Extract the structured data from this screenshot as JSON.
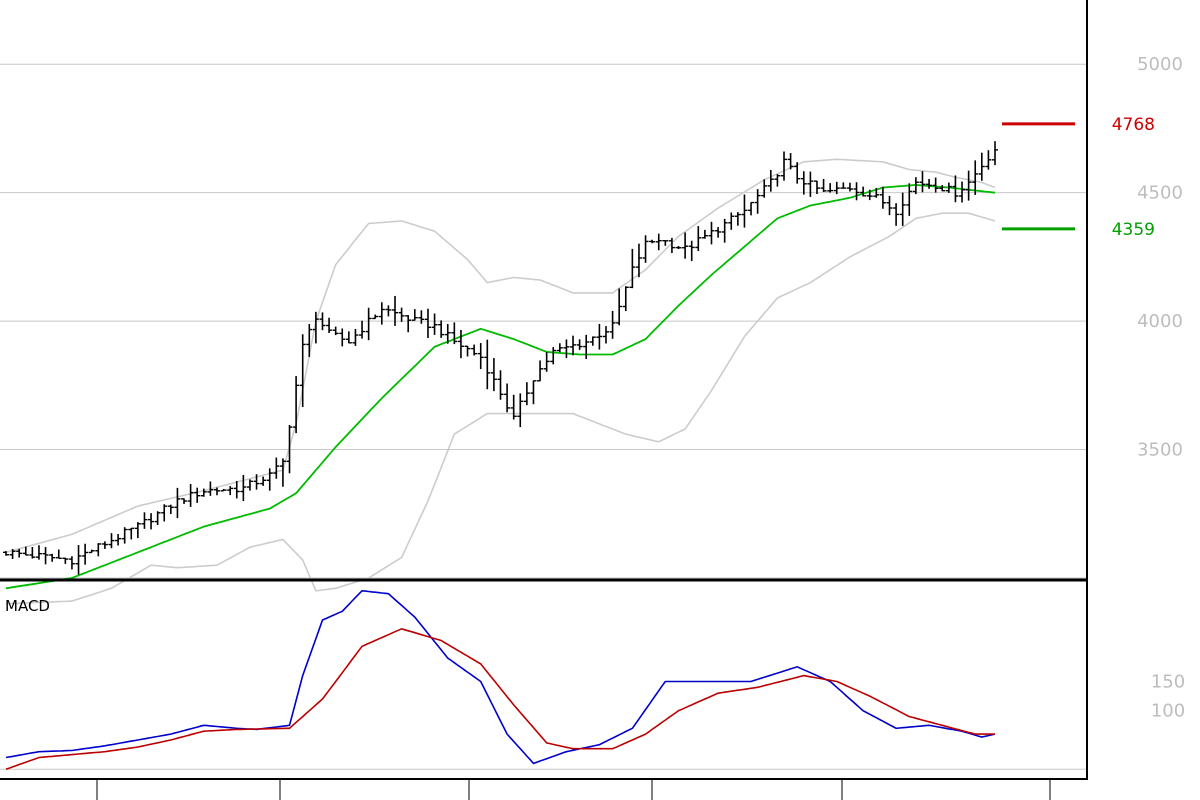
{
  "chart_data": [
    {
      "type": "ohlc",
      "panel": "price",
      "y_scale": "linear",
      "ylim": [
        3000,
        5250
      ],
      "y_ticks": [
        3500,
        4000,
        4500,
        5000
      ],
      "y_tick_labels": [
        "3500",
        "4000",
        "4500",
        "5000"
      ],
      "horizontal_grid_values": [
        3000,
        3500,
        4000,
        4500,
        5000
      ],
      "grid": "horizontal",
      "x_tick_labels_visible": false,
      "markers": [
        {
          "label": "4768",
          "value": 4768,
          "color": "#cc0000"
        },
        {
          "label": "4359",
          "value": 4359,
          "color": "#00a000"
        }
      ],
      "ohlc_keypoints": [
        [
          0,
          3100
        ],
        [
          10,
          3070
        ],
        [
          20,
          3200
        ],
        [
          26,
          3300
        ],
        [
          30,
          3340
        ],
        [
          36,
          3350
        ],
        [
          40,
          3400
        ],
        [
          42,
          3450
        ],
        [
          45,
          3900
        ],
        [
          47,
          4020
        ],
        [
          49,
          3950
        ],
        [
          52,
          3920
        ],
        [
          57,
          4050
        ],
        [
          62,
          4000
        ],
        [
          65,
          3980
        ],
        [
          68,
          3920
        ],
        [
          72,
          3860
        ],
        [
          75,
          3720
        ],
        [
          77,
          3620
        ],
        [
          80,
          3780
        ],
        [
          83,
          3880
        ],
        [
          88,
          3920
        ],
        [
          92,
          3980
        ],
        [
          95,
          4200
        ],
        [
          97,
          4300
        ],
        [
          99,
          4320
        ],
        [
          103,
          4280
        ],
        [
          108,
          4360
        ],
        [
          112,
          4430
        ],
        [
          116,
          4540
        ],
        [
          118,
          4620
        ],
        [
          120,
          4560
        ],
        [
          124,
          4500
        ],
        [
          128,
          4520
        ],
        [
          132,
          4480
        ],
        [
          135,
          4430
        ],
        [
          138,
          4540
        ],
        [
          141,
          4530
        ],
        [
          144,
          4500
        ],
        [
          146,
          4540
        ],
        [
          149,
          4640
        ],
        [
          150,
          4670
        ]
      ],
      "moving_average": {
        "color": "#00bb00",
        "points": [
          [
            0,
            2960
          ],
          [
            10,
            3000
          ],
          [
            20,
            3100
          ],
          [
            30,
            3200
          ],
          [
            40,
            3270
          ],
          [
            44,
            3330
          ],
          [
            50,
            3510
          ],
          [
            57,
            3700
          ],
          [
            65,
            3900
          ],
          [
            72,
            3970
          ],
          [
            77,
            3930
          ],
          [
            82,
            3880
          ],
          [
            87,
            3870
          ],
          [
            92,
            3870
          ],
          [
            97,
            3930
          ],
          [
            102,
            4060
          ],
          [
            107,
            4180
          ],
          [
            112,
            4290
          ],
          [
            117,
            4400
          ],
          [
            122,
            4450
          ],
          [
            128,
            4480
          ],
          [
            133,
            4520
          ],
          [
            138,
            4530
          ],
          [
            143,
            4520
          ],
          [
            150,
            4500
          ]
        ]
      },
      "bollinger_bands": {
        "color": "#cccccc",
        "upper": [
          [
            0,
            3100
          ],
          [
            10,
            3170
          ],
          [
            20,
            3280
          ],
          [
            30,
            3340
          ],
          [
            42,
            3420
          ],
          [
            44,
            3600
          ],
          [
            47,
            4000
          ],
          [
            50,
            4220
          ],
          [
            55,
            4380
          ],
          [
            60,
            4390
          ],
          [
            65,
            4350
          ],
          [
            70,
            4240
          ],
          [
            73,
            4150
          ],
          [
            77,
            4170
          ],
          [
            81,
            4160
          ],
          [
            86,
            4110
          ],
          [
            92,
            4110
          ],
          [
            97,
            4200
          ],
          [
            102,
            4330
          ],
          [
            108,
            4440
          ],
          [
            115,
            4550
          ],
          [
            121,
            4620
          ],
          [
            126,
            4630
          ],
          [
            133,
            4620
          ],
          [
            137,
            4590
          ],
          [
            141,
            4580
          ],
          [
            144,
            4560
          ],
          [
            148,
            4540
          ],
          [
            150,
            4520
          ]
        ],
        "lower": [
          [
            0,
            2900
          ],
          [
            10,
            2910
          ],
          [
            16,
            2960
          ],
          [
            22,
            3050
          ],
          [
            26,
            3040
          ],
          [
            32,
            3050
          ],
          [
            37,
            3120
          ],
          [
            42,
            3150
          ],
          [
            45,
            3070
          ],
          [
            47,
            2950
          ],
          [
            50,
            2960
          ],
          [
            55,
            3000
          ],
          [
            60,
            3080
          ],
          [
            64,
            3300
          ],
          [
            68,
            3560
          ],
          [
            73,
            3640
          ],
          [
            79,
            3640
          ],
          [
            86,
            3640
          ],
          [
            94,
            3560
          ],
          [
            99,
            3530
          ],
          [
            103,
            3580
          ],
          [
            107,
            3730
          ],
          [
            112,
            3940
          ],
          [
            117,
            4090
          ],
          [
            122,
            4150
          ],
          [
            128,
            4250
          ],
          [
            134,
            4330
          ],
          [
            138,
            4400
          ],
          [
            142,
            4420
          ],
          [
            146,
            4420
          ],
          [
            150,
            4390
          ]
        ]
      }
    },
    {
      "type": "line",
      "panel": "indicator",
      "title": "MACD",
      "ylim": [
        -15,
        320
      ],
      "y_ticks": [
        100,
        150
      ],
      "y_tick_labels": [
        "100",
        "150"
      ],
      "horizontal_grid_values": [
        0
      ],
      "series": [
        {
          "color": "#0000cc",
          "points": [
            [
              0,
              20
            ],
            [
              5,
              30
            ],
            [
              10,
              32
            ],
            [
              15,
              40
            ],
            [
              20,
              50
            ],
            [
              25,
              60
            ],
            [
              30,
              75
            ],
            [
              35,
              70
            ],
            [
              38,
              68
            ],
            [
              43,
              75
            ],
            [
              45,
              160
            ],
            [
              48,
              255
            ],
            [
              51,
              270
            ],
            [
              54,
              305
            ],
            [
              58,
              300
            ],
            [
              62,
              260
            ],
            [
              67,
              190
            ],
            [
              72,
              150
            ],
            [
              76,
              60
            ],
            [
              80,
              10
            ],
            [
              85,
              30
            ],
            [
              90,
              42
            ],
            [
              95,
              70
            ],
            [
              100,
              150
            ],
            [
              105,
              150
            ],
            [
              110,
              150
            ],
            [
              113,
              150
            ],
            [
              120,
              175
            ],
            [
              125,
              150
            ],
            [
              130,
              100
            ],
            [
              135,
              70
            ],
            [
              140,
              75
            ],
            [
              145,
              65
            ],
            [
              148,
              55
            ],
            [
              150,
              60
            ]
          ]
        },
        {
          "color": "#bb0000",
          "points": [
            [
              0,
              0
            ],
            [
              5,
              20
            ],
            [
              10,
              25
            ],
            [
              15,
              30
            ],
            [
              20,
              38
            ],
            [
              25,
              50
            ],
            [
              30,
              65
            ],
            [
              35,
              68
            ],
            [
              43,
              70
            ],
            [
              48,
              120
            ],
            [
              54,
              210
            ],
            [
              60,
              240
            ],
            [
              66,
              220
            ],
            [
              72,
              180
            ],
            [
              77,
              110
            ],
            [
              82,
              45
            ],
            [
              86,
              35
            ],
            [
              92,
              35
            ],
            [
              97,
              60
            ],
            [
              102,
              100
            ],
            [
              108,
              130
            ],
            [
              114,
              140
            ],
            [
              121,
              160
            ],
            [
              126,
              150
            ],
            [
              131,
              125
            ],
            [
              137,
              90
            ],
            [
              142,
              75
            ],
            [
              147,
              60
            ],
            [
              150,
              60
            ]
          ]
        }
      ]
    }
  ]
}
